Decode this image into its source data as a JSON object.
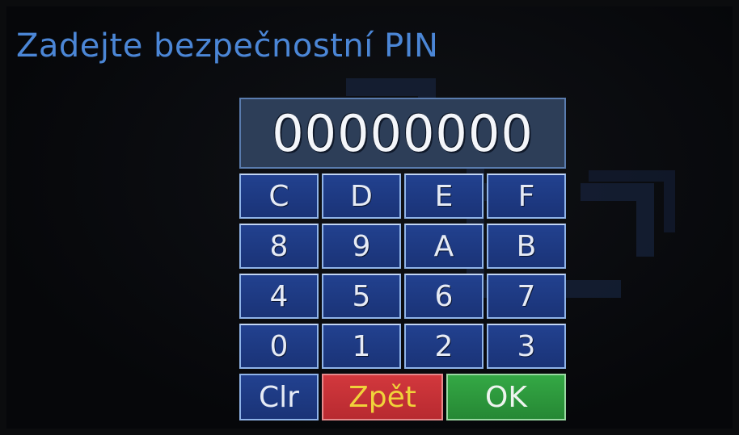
{
  "title": "Zadejte bezpečnostní PIN",
  "pin_display": "00000000",
  "keys": [
    "C",
    "D",
    "E",
    "F",
    "8",
    "9",
    "A",
    "B",
    "4",
    "5",
    "6",
    "7",
    "0",
    "1",
    "2",
    "3"
  ],
  "actions": {
    "clear_label": "Clr",
    "back_label": "Zpět",
    "ok_label": "OK"
  },
  "colors": {
    "title": "#4b86d6",
    "key_background": "#1f3a86",
    "back_button": "#c53036",
    "back_text": "#f0d23a",
    "ok_button": "#2f9b3e"
  }
}
